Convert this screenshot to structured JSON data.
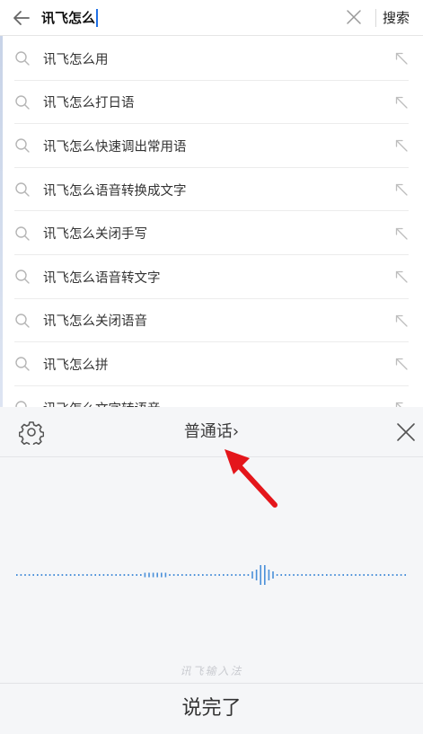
{
  "search": {
    "query": "讯飞怎么",
    "submit_label": "搜索"
  },
  "suggestions": [
    {
      "label": "讯飞怎么用"
    },
    {
      "label": "讯飞怎么打日语"
    },
    {
      "label": "讯飞怎么快速调出常用语"
    },
    {
      "label": "讯飞怎么语音转换成文字"
    },
    {
      "label": "讯飞怎么关闭手写"
    },
    {
      "label": "讯飞怎么语音转文字"
    },
    {
      "label": "讯飞怎么关闭语音"
    },
    {
      "label": "讯飞怎么拼"
    },
    {
      "label": "讯飞怎么文字转语音"
    }
  ],
  "voice_panel": {
    "language_label": "普通话",
    "language_chevron": "›",
    "watermark": "讯飞输入法",
    "done_label": "说完了"
  },
  "icons": {
    "back": "back-arrow-icon",
    "clear": "close-icon",
    "suggest_search": "search-icon",
    "fill_query": "arrow-up-left-icon",
    "settings": "gear-icon",
    "close_panel": "close-icon"
  },
  "colors": {
    "accent_blue": "#1f6fe5",
    "waveform_blue": "#4a90d9",
    "annotation_red": "#e4161b",
    "panel_bg": "#f5f6f8"
  }
}
